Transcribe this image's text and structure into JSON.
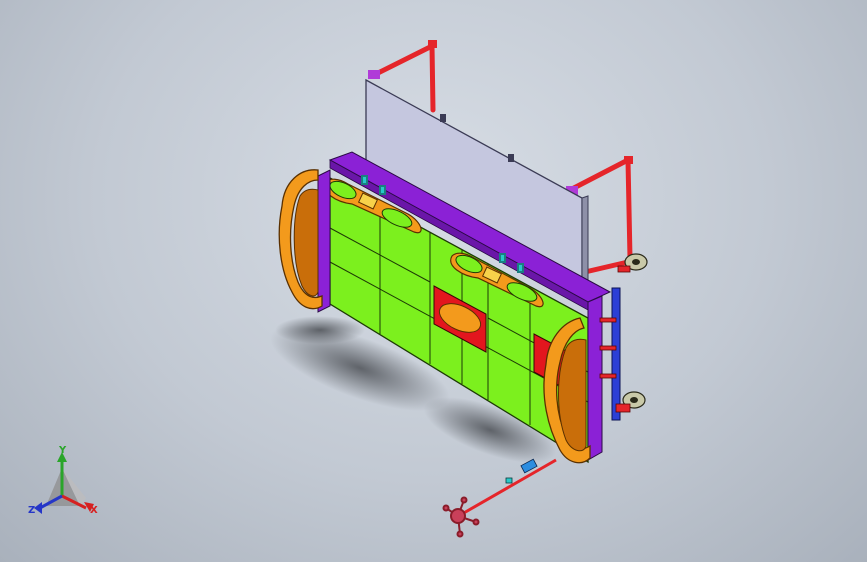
{
  "viewport": {
    "background_top": "#d7dde5",
    "background_bottom": "#a9b1bc"
  },
  "model": {
    "part_colors": {
      "panel_green": "#7cf01e",
      "frame_orange": "#f39a1c",
      "rail_purple": "#8b21d6",
      "pipe_red": "#e5252a",
      "board_lavender": "#c5c7df",
      "block_red": "#e3161e",
      "post_blue": "#2c3fd6",
      "wheel_tan": "#c9c9a8",
      "accent_cyan": "#27c9c9"
    }
  },
  "triad": {
    "icon": "coordinate-triad-icon",
    "y_label": "Y",
    "x_label": "X",
    "z_label": "Z",
    "y_color": "#2aa52a",
    "x_color": "#d62020",
    "z_color": "#2536c8"
  }
}
